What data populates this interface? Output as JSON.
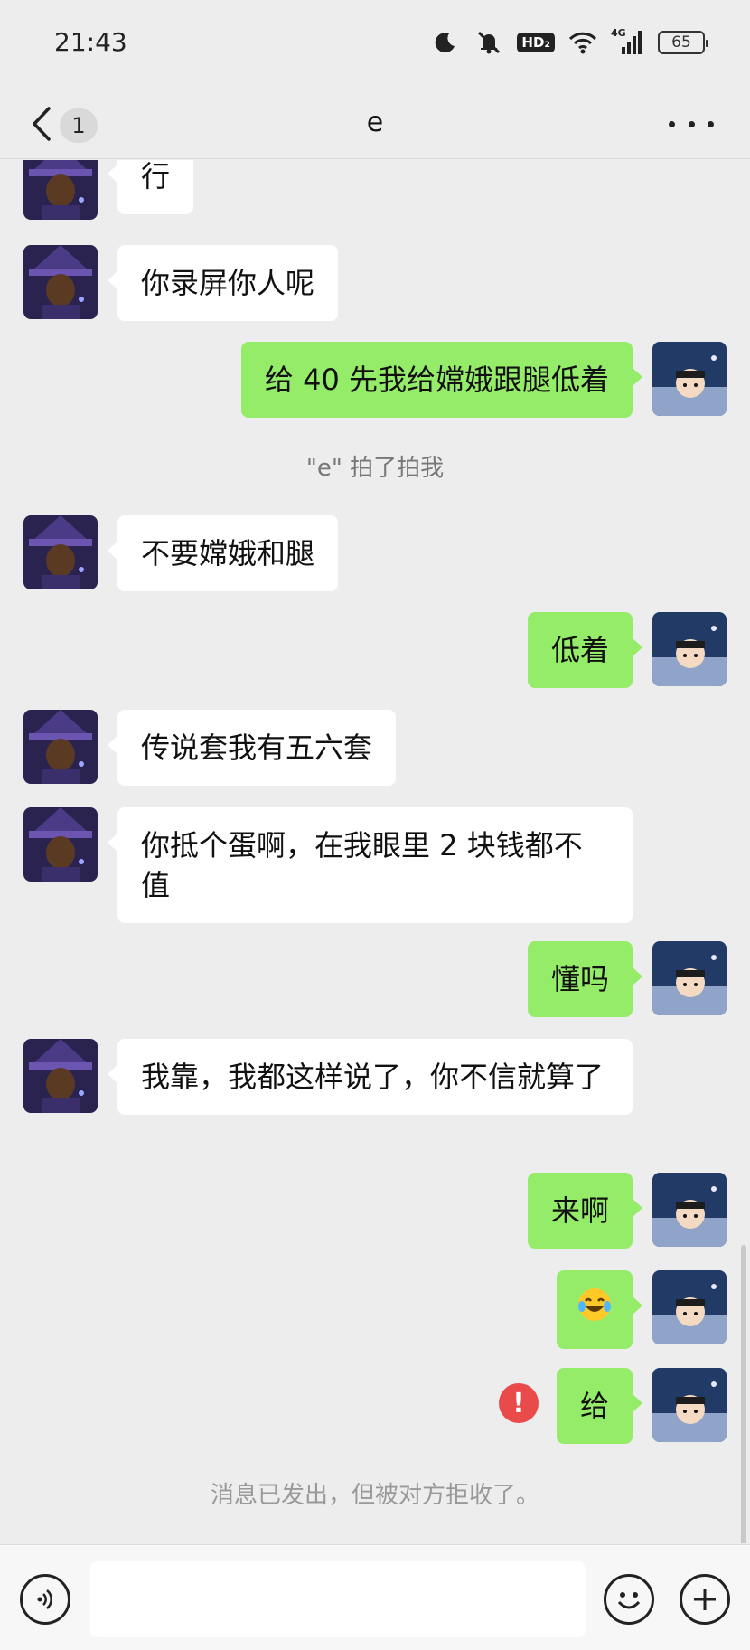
{
  "status_bar": {
    "time": "21:43",
    "hd_label": "HD₂",
    "network_label": "4G",
    "battery_level": "65"
  },
  "nav": {
    "title": "e",
    "unread_count": "1"
  },
  "messages": [
    {
      "side": "in",
      "text": "行"
    },
    {
      "side": "in",
      "text": "你录屏你人呢"
    },
    {
      "side": "out",
      "text": "给 40 先我给嫦娥跟腿低着"
    },
    {
      "side": "system",
      "text": "\"e\" 拍了拍我"
    },
    {
      "side": "in",
      "text": "不要嫦娥和腿"
    },
    {
      "side": "out",
      "text": "低着"
    },
    {
      "side": "in",
      "text": "传说套我有五六套"
    },
    {
      "side": "in",
      "text": "你抵个蛋啊，在我眼里 2 块钱都不值"
    },
    {
      "side": "out",
      "text": "懂吗"
    },
    {
      "side": "in",
      "text": "我靠，我都这样说了，你不信就算了"
    },
    {
      "side": "out",
      "text": "来啊"
    },
    {
      "side": "out",
      "emoji": "laughing-crying-emoji"
    },
    {
      "side": "out",
      "text": "给",
      "failed": true,
      "error_symbol": "!"
    },
    {
      "side": "system",
      "text": "消息已发出，但被对方拒收了。"
    }
  ],
  "colors": {
    "background": "#EDEDED",
    "outgoing_bubble": "#95EC69",
    "incoming_bubble": "#FFFFFF",
    "error": "#E94B4B"
  },
  "input": {
    "value": ""
  }
}
